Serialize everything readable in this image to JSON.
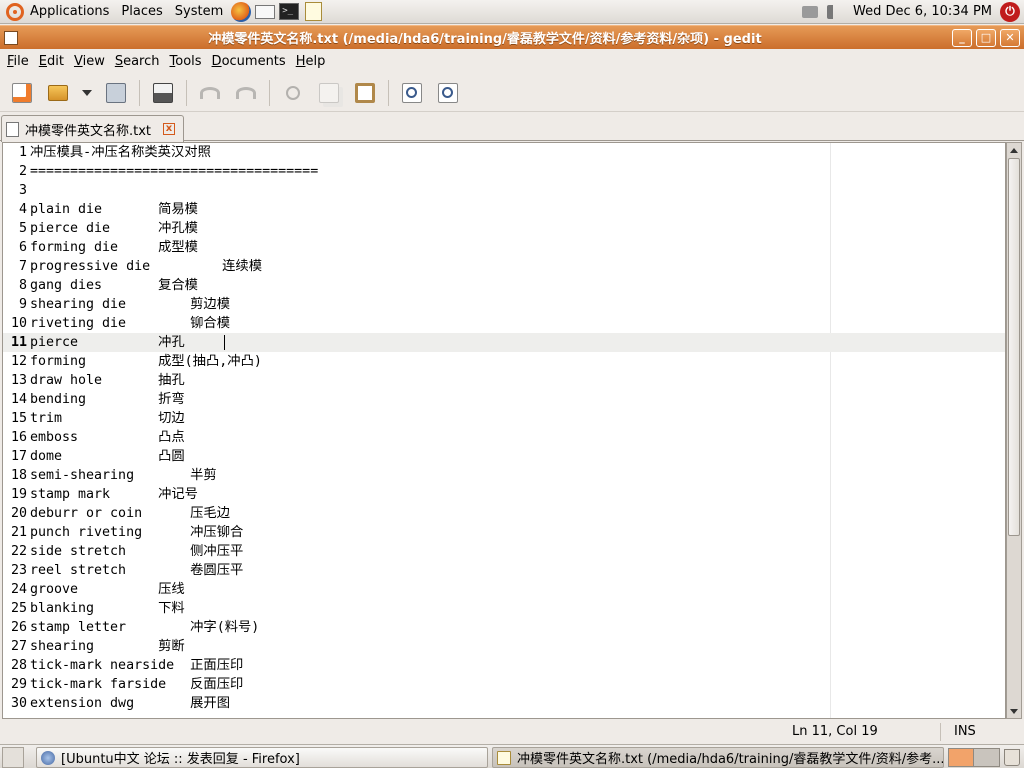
{
  "top_panel": {
    "menus": [
      "Applications",
      "Places",
      "System"
    ],
    "clock": "Wed Dec  6, 10:34 PM"
  },
  "window": {
    "title": "冲模零件英文名称.txt (/media/hda6/training/睿磊教学文件/资料/参考资料/杂项) - gedit",
    "minimize": "_",
    "maximize": "□",
    "close": "✕"
  },
  "menubar": {
    "items": [
      {
        "label": "File",
        "mnemonic": "F",
        "rest": "ile"
      },
      {
        "label": "Edit",
        "mnemonic": "E",
        "rest": "dit"
      },
      {
        "label": "View",
        "mnemonic": "V",
        "rest": "iew"
      },
      {
        "label": "Search",
        "mnemonic": "S",
        "rest": "earch"
      },
      {
        "label": "Tools",
        "mnemonic": "T",
        "rest": "ools"
      },
      {
        "label": "Documents",
        "mnemonic": "D",
        "rest": "ocuments"
      },
      {
        "label": "Help",
        "mnemonic": "H",
        "rest": "elp"
      }
    ]
  },
  "tab": {
    "label": "冲模零件英文名称.txt",
    "close": "x"
  },
  "editor": {
    "current_line": 11,
    "lines": [
      {
        "n": "1",
        "text": "冲压模具-冲压名称类英汉对照"
      },
      {
        "n": "2",
        "text": "===================================="
      },
      {
        "n": "3",
        "text": ""
      },
      {
        "n": "4",
        "text": "plain die       简易模"
      },
      {
        "n": "5",
        "text": "pierce die      冲孔模"
      },
      {
        "n": "6",
        "text": "forming die     成型模"
      },
      {
        "n": "7",
        "text": "progressive die         连续模"
      },
      {
        "n": "8",
        "text": "gang dies       复合模"
      },
      {
        "n": "9",
        "text": "shearing die        剪边模"
      },
      {
        "n": "10",
        "text": "riveting die        铆合模"
      },
      {
        "n": "11",
        "text": "pierce          冲孔"
      },
      {
        "n": "12",
        "text": "forming         成型(抽凸,冲凸)"
      },
      {
        "n": "13",
        "text": "draw hole       抽孔"
      },
      {
        "n": "14",
        "text": "bending         折弯"
      },
      {
        "n": "15",
        "text": "trim            切边"
      },
      {
        "n": "16",
        "text": "emboss          凸点"
      },
      {
        "n": "17",
        "text": "dome            凸圆"
      },
      {
        "n": "18",
        "text": "semi-shearing       半剪"
      },
      {
        "n": "19",
        "text": "stamp mark      冲记号"
      },
      {
        "n": "20",
        "text": "deburr or coin      压毛边"
      },
      {
        "n": "21",
        "text": "punch riveting      冲压铆合"
      },
      {
        "n": "22",
        "text": "side stretch        侧冲压平"
      },
      {
        "n": "23",
        "text": "reel stretch        卷圆压平"
      },
      {
        "n": "24",
        "text": "groove          压线"
      },
      {
        "n": "25",
        "text": "blanking        下料"
      },
      {
        "n": "26",
        "text": "stamp letter        冲字(料号)"
      },
      {
        "n": "27",
        "text": "shearing        剪断"
      },
      {
        "n": "28",
        "text": "tick-mark nearside  正面压印"
      },
      {
        "n": "29",
        "text": "tick-mark farside   反面压印"
      },
      {
        "n": "30",
        "text": "extension dwg       展开图"
      }
    ]
  },
  "statusbar": {
    "position": "Ln 11, Col 19",
    "mode": "INS"
  },
  "taskbar": {
    "tasks": [
      {
        "label": "[Ubuntu中文 论坛 :: 发表回复 - Firefox]",
        "active": false
      },
      {
        "label": "冲模零件英文名称.txt (/media/hda6/training/睿磊教学文件/资料/参考...",
        "active": true
      }
    ]
  },
  "colors": {
    "titlebar": "#cb6e2b",
    "current_line": "#eeeeec",
    "workspace_active": "#f2a36a"
  }
}
